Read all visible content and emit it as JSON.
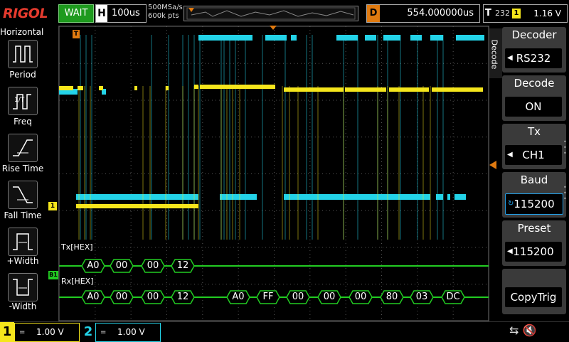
{
  "brand": "RIGOL",
  "run_status": "WAIT",
  "horizontal": {
    "tag": "H",
    "timebase": "100us"
  },
  "sampling": {
    "rate": "500MSa/s",
    "points": "600k pts"
  },
  "delay": {
    "tag": "D",
    "value": "554.000000us"
  },
  "trigger": {
    "tag": "T",
    "source_num": "232",
    "channel": "1",
    "level": "1.16 V"
  },
  "left_menu": {
    "title": "Horizontal",
    "items": [
      {
        "label": "Period",
        "icon": "period-icon"
      },
      {
        "label": "Freq",
        "icon": "freq-icon"
      },
      {
        "label": "Rise Time",
        "icon": "rise-time-icon"
      },
      {
        "label": "Fall Time",
        "icon": "fall-time-icon"
      },
      {
        "label": "+Width",
        "icon": "pos-width-icon"
      },
      {
        "label": "-Width",
        "icon": "neg-width-icon"
      }
    ]
  },
  "right_menu": {
    "tab": "Decode",
    "items": [
      {
        "title": "Decoder",
        "value": "RS232"
      },
      {
        "title": "Decode",
        "value": "ON"
      },
      {
        "title": "Tx",
        "value": "CH1"
      },
      {
        "title": "Baud",
        "value": "115200"
      },
      {
        "title": "Preset",
        "value": "115200"
      },
      {
        "title": "",
        "value": "CopyTrig"
      }
    ]
  },
  "markers": {
    "trig_pos": "T",
    "ch1": "1",
    "bus": "B1"
  },
  "decode": {
    "tx": {
      "label": "Tx[HEX]",
      "bytes": [
        "A0",
        "00",
        "00",
        "12"
      ]
    },
    "rx": {
      "label": "Rx[HEX]",
      "bytes": [
        "A0",
        "00",
        "00",
        "12",
        "A0",
        "FF",
        "00",
        "00",
        "00",
        "80",
        "03",
        "DC"
      ]
    }
  },
  "channels": [
    {
      "num": "1",
      "scale": "1.00 V",
      "color": "#f5e61c"
    },
    {
      "num": "2",
      "scale": "1.00 V",
      "color": "#23d3e8"
    }
  ],
  "colors": {
    "ch1": "#f5e61c",
    "ch2": "#23d3e8",
    "bus": "#22cc22",
    "trig": "#e07a10"
  }
}
